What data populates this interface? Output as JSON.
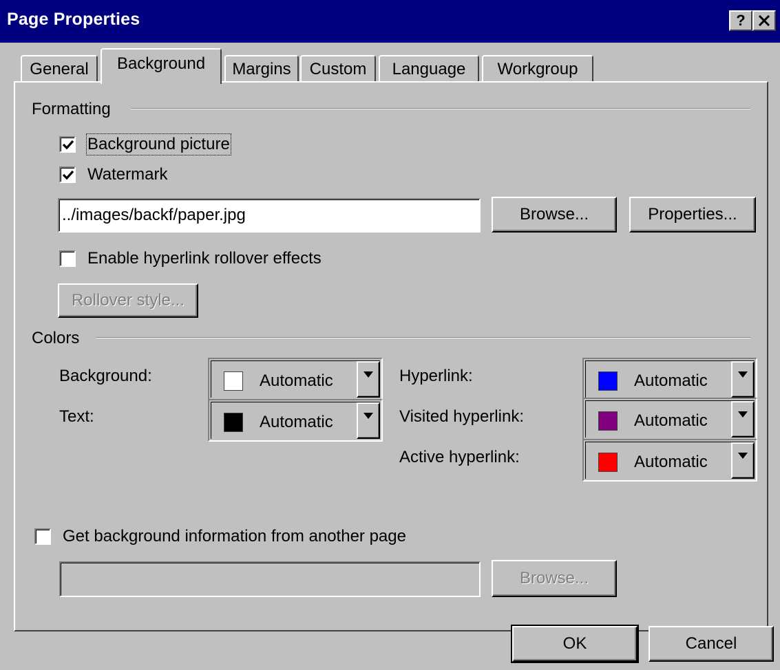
{
  "window": {
    "title": "Page Properties",
    "help_button": "?",
    "close_button": "✕"
  },
  "tabs": [
    {
      "label": "General",
      "active": false
    },
    {
      "label": "Background",
      "active": true
    },
    {
      "label": "Margins",
      "active": false
    },
    {
      "label": "Custom",
      "active": false
    },
    {
      "label": "Language",
      "active": false
    },
    {
      "label": "Workgroup",
      "active": false
    }
  ],
  "formatting": {
    "group_label": "Formatting",
    "background_picture": {
      "label": "Background picture",
      "checked": true
    },
    "watermark": {
      "label": "Watermark",
      "checked": true
    },
    "image_path": "../images/backf/paper.jpg",
    "browse_label": "Browse...",
    "properties_label": "Properties...",
    "rollover": {
      "label": "Enable hyperlink rollover effects",
      "checked": false
    },
    "rollover_style_label": "Rollover style..."
  },
  "colors": {
    "group_label": "Colors",
    "background": {
      "label": "Background:",
      "value": "Automatic",
      "swatch": "#ffffff"
    },
    "text": {
      "label": "Text:",
      "value": "Automatic",
      "swatch": "#000000"
    },
    "hyperlink": {
      "label": "Hyperlink:",
      "value": "Automatic",
      "swatch": "#0000ff"
    },
    "visited_hyperlink": {
      "label": "Visited hyperlink:",
      "value": "Automatic",
      "swatch": "#800080"
    },
    "active_hyperlink": {
      "label": "Active hyperlink:",
      "value": "Automatic",
      "swatch": "#ff0000"
    }
  },
  "another_page": {
    "label": "Get background information from another page",
    "checked": false,
    "path_value": "",
    "browse_label": "Browse..."
  },
  "footer": {
    "ok_label": "OK",
    "cancel_label": "Cancel"
  },
  "theme": {
    "titlebar": "#00007f",
    "face": "#c0c0c0"
  }
}
